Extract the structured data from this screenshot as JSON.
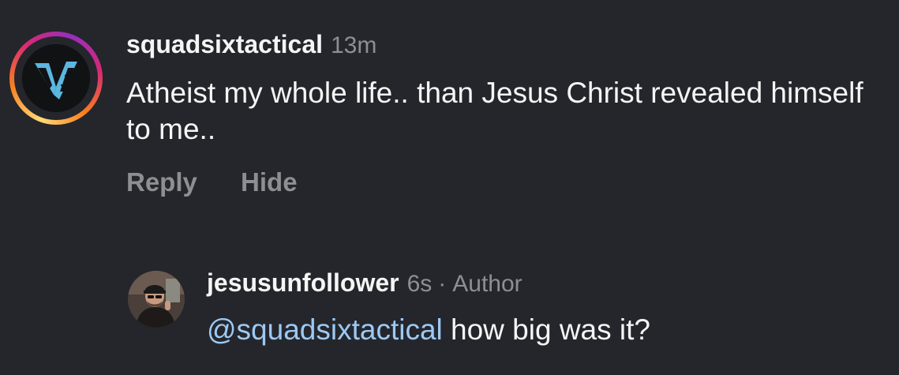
{
  "comments": [
    {
      "username": "squadsixtactical",
      "time": "13m",
      "text": "Atheist my whole life.. than Jesus Christ revealed himself to me..",
      "actions": {
        "reply": "Reply",
        "hide": "Hide"
      },
      "avatar_icon": "v6-logo"
    }
  ],
  "reply": {
    "username": "jesusunfollower",
    "time": "6s",
    "separator": "·",
    "role": "Author",
    "mention": "@squadsixtactical",
    "text": " how big was it?",
    "avatar_icon": "user-photo"
  },
  "colors": {
    "background": "#25262b",
    "text": "#f5f5f5",
    "muted": "#8e8e93",
    "mention": "#9cc9f5",
    "logo_blue": "#5bb7e0"
  }
}
